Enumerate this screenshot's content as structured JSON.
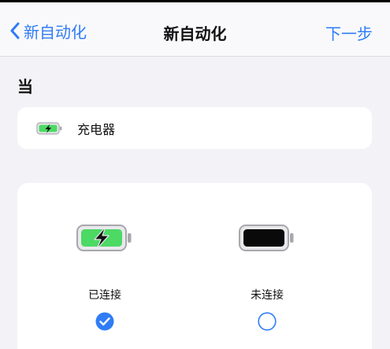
{
  "navbar": {
    "back_label": "新自动化",
    "title": "新自动化",
    "next_label": "下一步"
  },
  "section": {
    "label": "当"
  },
  "trigger": {
    "icon": "charging-battery-icon",
    "label": "充电器"
  },
  "options": [
    {
      "label": "已连接",
      "icon": "charging-battery-icon",
      "selected": true
    },
    {
      "label": "未连接",
      "icon": "full-battery-icon",
      "selected": false
    }
  ],
  "colors": {
    "accent": "#2f7cf6",
    "battery_green": "#4cd964",
    "background": "#f2f2f7",
    "card": "#ffffff"
  }
}
